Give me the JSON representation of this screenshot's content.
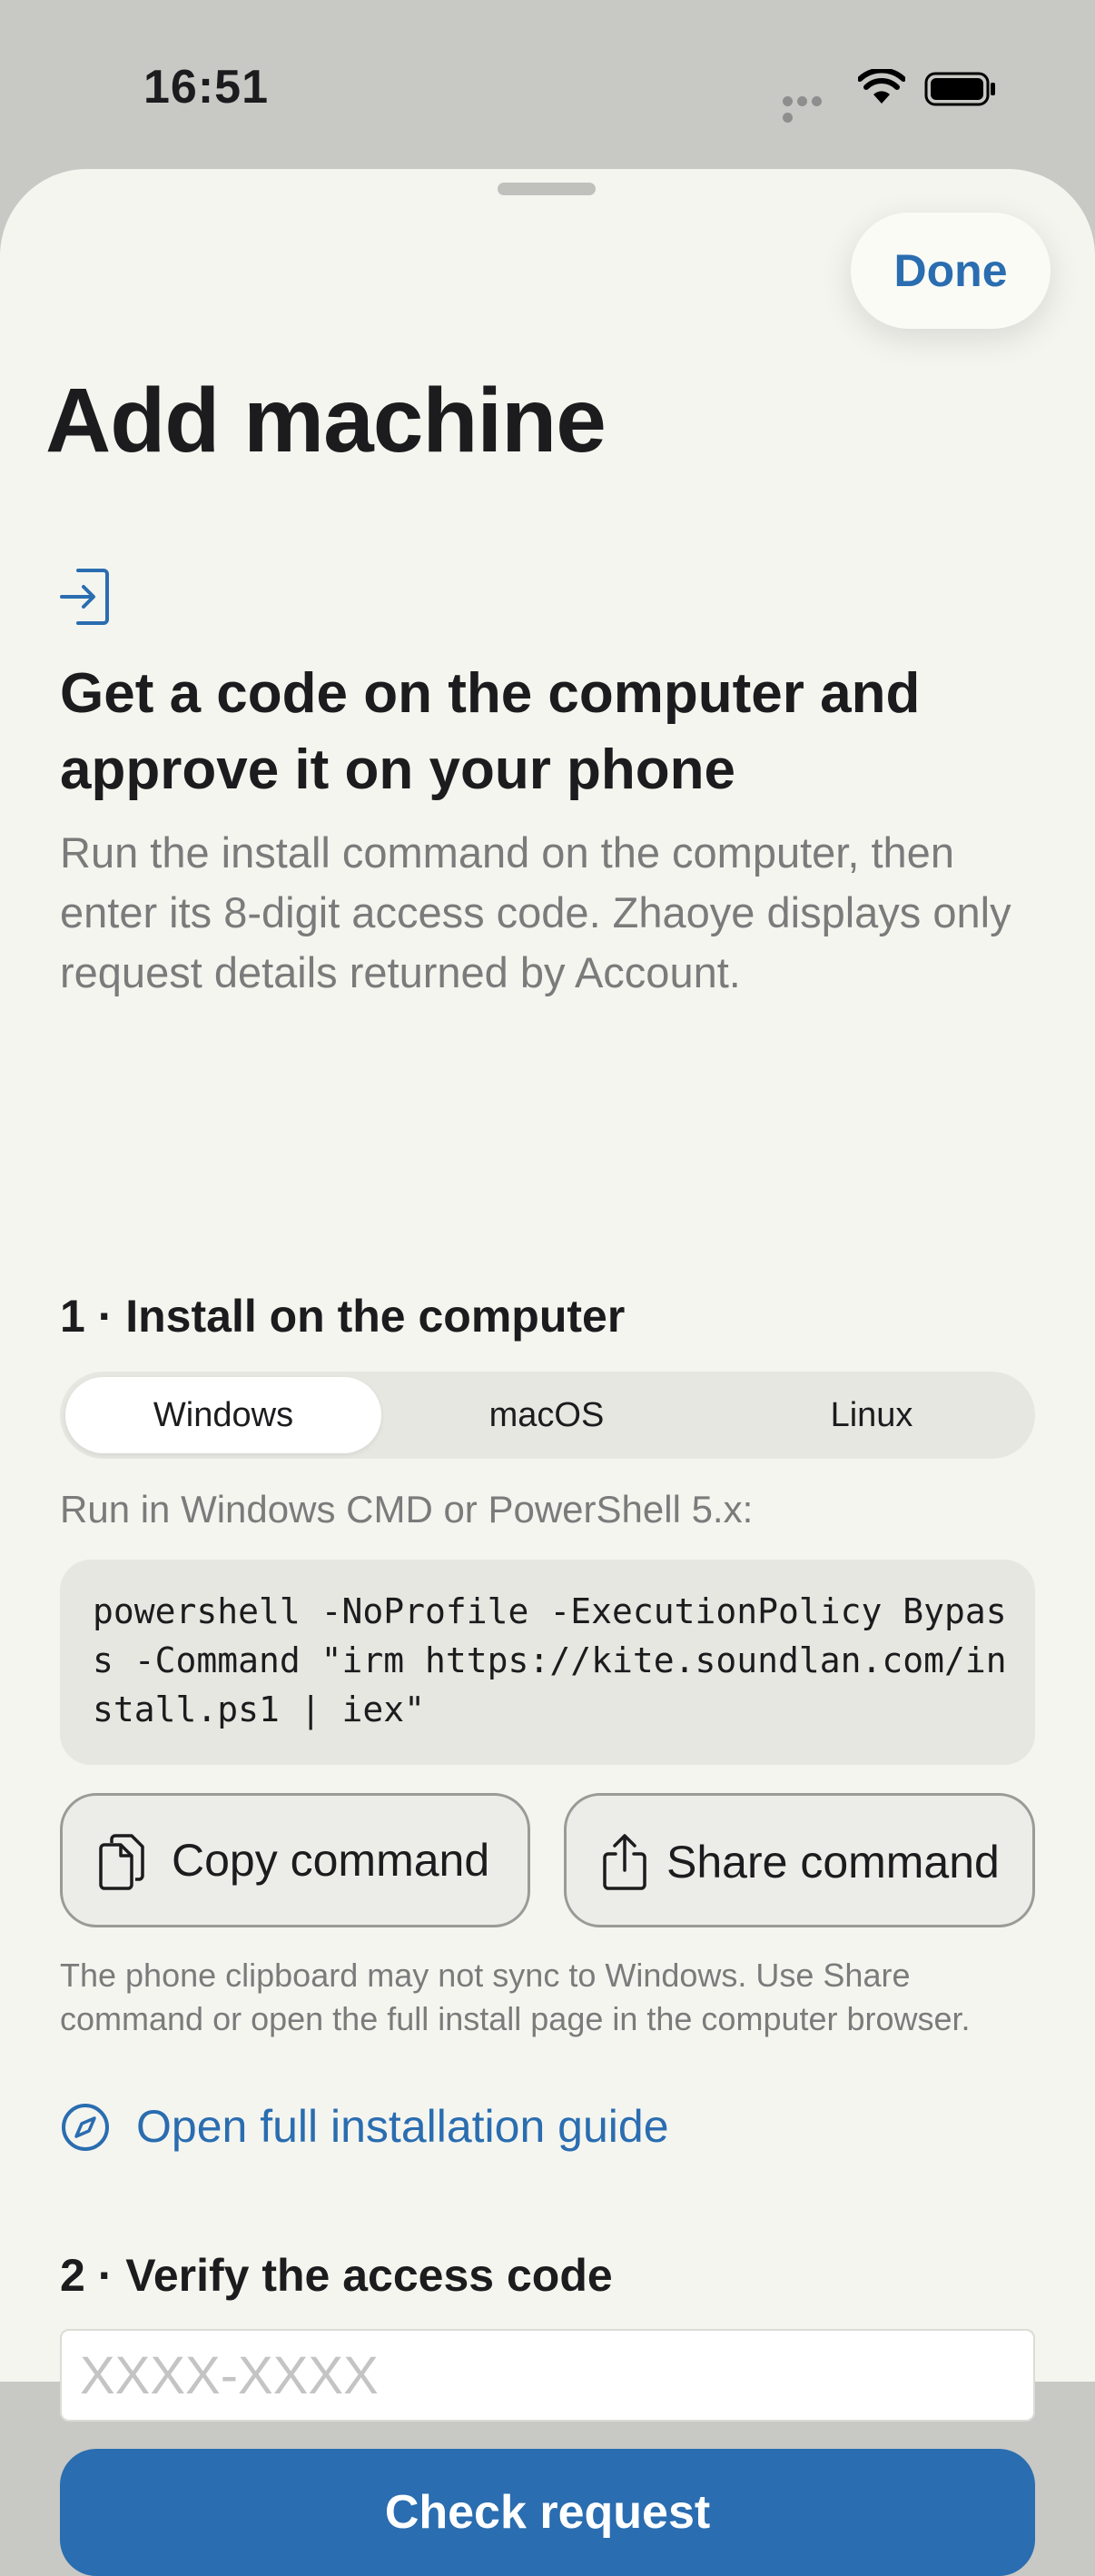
{
  "status_bar": {
    "time": "16:51"
  },
  "sheet": {
    "done_label": "Done",
    "title": "Add machine"
  },
  "intro": {
    "heading": "Get a code on the computer and approve it on your phone",
    "description": "Run the install command on the computer, then enter its 8-digit access code. Zhaoye displays only request details returned by Account."
  },
  "step1": {
    "title": "1 · Install on the computer",
    "platforms": [
      "Windows",
      "macOS",
      "Linux"
    ],
    "selected_platform": "Windows",
    "run_hint": "Run in Windows CMD or PowerShell 5.x:",
    "command": "powershell -NoProfile -ExecutionPolicy Bypass -Command \"irm https://kite.soundlan.com/install.ps1 | iex\"",
    "copy_label": "Copy command",
    "share_label": "Share command",
    "clipboard_note": "The phone clipboard may not sync to Windows. Use Share command or open the full install page in the computer browser.",
    "guide_link": "Open full installation guide"
  },
  "step2": {
    "title": "2 · Verify the access code",
    "code_placeholder": "XXXX-XXXX",
    "code_value": "",
    "check_label": "Check request"
  },
  "colors": {
    "accent": "#2a6db0",
    "sheet_background": "#f5f5f0",
    "secondary_text": "#7b7b7b"
  },
  "icons": {
    "intro": "enter-icon",
    "copy": "copy-icon",
    "share": "share-icon",
    "guide": "compass-icon"
  }
}
